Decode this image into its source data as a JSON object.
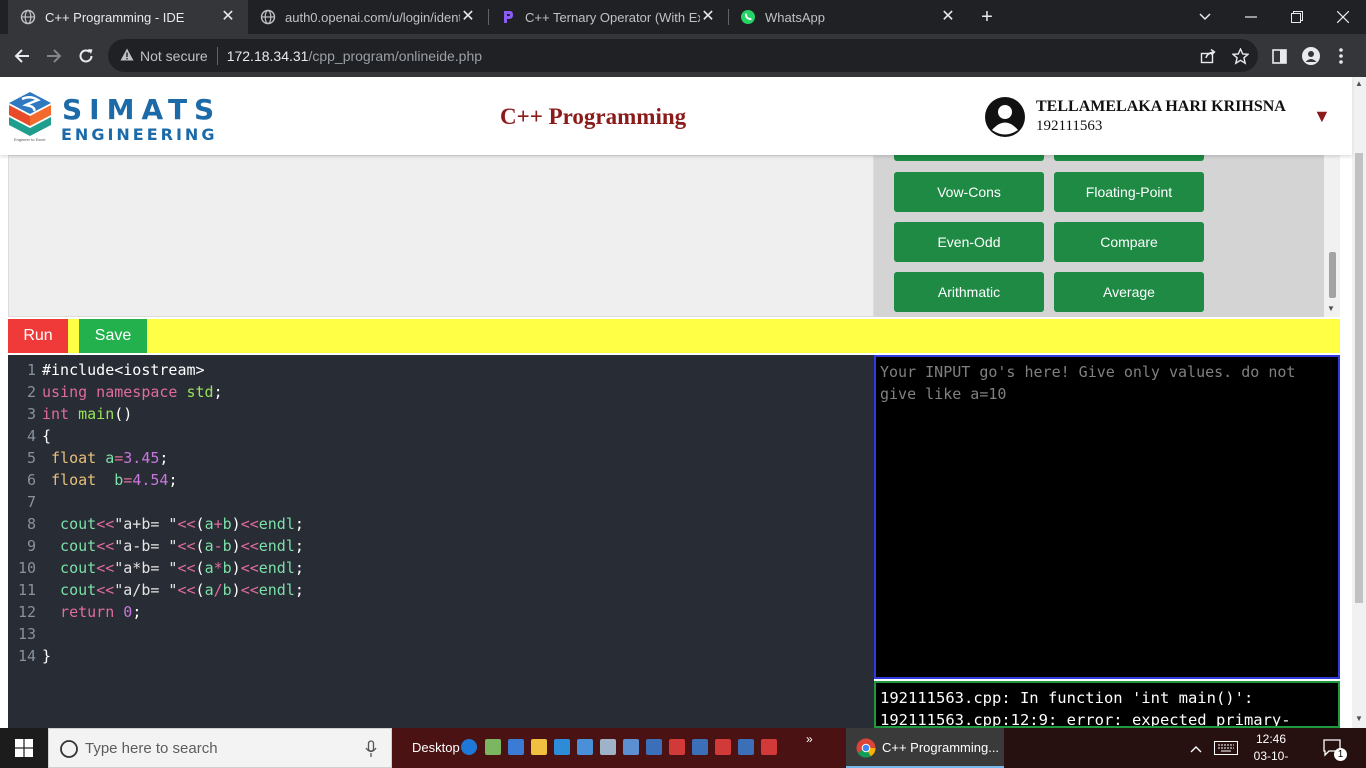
{
  "browser": {
    "tabs": [
      {
        "title": "C++ Programming - IDE",
        "active": true
      },
      {
        "title": "auth0.openai.com/u/login/identi",
        "active": false
      },
      {
        "title": "C++ Ternary Operator (With Exa",
        "active": false
      },
      {
        "title": "WhatsApp",
        "active": false
      }
    ],
    "address": {
      "security": "Not secure",
      "host": "172.18.34.31",
      "path": "/cpp_program/onlineide.php"
    }
  },
  "header": {
    "logo_line1": "SIMATS",
    "logo_line2": "ENGINEERING",
    "logo_tagline": "Engineer to Excel",
    "title": "C++ Programming",
    "user_name": "TELLAMELAKA HARI KRIHSNA",
    "user_id": "192111563",
    "caret": "▼"
  },
  "programs": {
    "buttons": [
      "Vow-Cons",
      "Floating-Point",
      "Even-Odd",
      "Compare",
      "Arithmatic",
      "Average"
    ]
  },
  "actions": {
    "run": "Run",
    "save": "Save"
  },
  "editor": {
    "lines": [
      {
        "n": "1",
        "tokens": [
          {
            "t": "#include<iostream>",
            "c": "plain"
          }
        ]
      },
      {
        "n": "2",
        "tokens": [
          {
            "t": "using namespace ",
            "c": "kw"
          },
          {
            "t": "std",
            "c": "fn"
          },
          {
            "t": ";",
            "c": "plain"
          }
        ]
      },
      {
        "n": "3",
        "tokens": [
          {
            "t": "int ",
            "c": "kw"
          },
          {
            "t": "main",
            "c": "fn"
          },
          {
            "t": "()",
            "c": "plain"
          }
        ]
      },
      {
        "n": "4",
        "tokens": [
          {
            "t": "{",
            "c": "plain"
          }
        ]
      },
      {
        "n": "5",
        "tokens": [
          {
            "t": " float ",
            "c": "type"
          },
          {
            "t": "a",
            "c": "var"
          },
          {
            "t": "=",
            "c": "op"
          },
          {
            "t": "3.45",
            "c": "num"
          },
          {
            "t": ";",
            "c": "plain"
          }
        ]
      },
      {
        "n": "6",
        "tokens": [
          {
            "t": " float  ",
            "c": "type"
          },
          {
            "t": "b",
            "c": "var"
          },
          {
            "t": "=",
            "c": "op"
          },
          {
            "t": "4.54",
            "c": "num"
          },
          {
            "t": ";",
            "c": "plain"
          }
        ]
      },
      {
        "n": "7",
        "tokens": []
      },
      {
        "n": "8",
        "tokens": [
          {
            "t": "  cout",
            "c": "var"
          },
          {
            "t": "<<",
            "c": "op"
          },
          {
            "t": "\"a+b= \"",
            "c": "str"
          },
          {
            "t": "<<",
            "c": "op"
          },
          {
            "t": "(",
            "c": "plain"
          },
          {
            "t": "a",
            "c": "var"
          },
          {
            "t": "+",
            "c": "op"
          },
          {
            "t": "b",
            "c": "var"
          },
          {
            "t": ")",
            "c": "plain"
          },
          {
            "t": "<<",
            "c": "op"
          },
          {
            "t": "endl",
            "c": "var"
          },
          {
            "t": ";",
            "c": "plain"
          }
        ]
      },
      {
        "n": "9",
        "tokens": [
          {
            "t": "  cout",
            "c": "var"
          },
          {
            "t": "<<",
            "c": "op"
          },
          {
            "t": "\"a-b= \"",
            "c": "str"
          },
          {
            "t": "<<",
            "c": "op"
          },
          {
            "t": "(",
            "c": "plain"
          },
          {
            "t": "a",
            "c": "var"
          },
          {
            "t": "-",
            "c": "op"
          },
          {
            "t": "b",
            "c": "var"
          },
          {
            "t": ")",
            "c": "plain"
          },
          {
            "t": "<<",
            "c": "op"
          },
          {
            "t": "endl",
            "c": "var"
          },
          {
            "t": ";",
            "c": "plain"
          }
        ]
      },
      {
        "n": "10",
        "tokens": [
          {
            "t": "  cout",
            "c": "var"
          },
          {
            "t": "<<",
            "c": "op"
          },
          {
            "t": "\"a*b= \"",
            "c": "str"
          },
          {
            "t": "<<",
            "c": "op"
          },
          {
            "t": "(",
            "c": "plain"
          },
          {
            "t": "a",
            "c": "var"
          },
          {
            "t": "*",
            "c": "op"
          },
          {
            "t": "b",
            "c": "var"
          },
          {
            "t": ")",
            "c": "plain"
          },
          {
            "t": "<<",
            "c": "op"
          },
          {
            "t": "endl",
            "c": "var"
          },
          {
            "t": ";",
            "c": "plain"
          }
        ]
      },
      {
        "n": "11",
        "tokens": [
          {
            "t": "  cout",
            "c": "var"
          },
          {
            "t": "<<",
            "c": "op"
          },
          {
            "t": "\"a/b= \"",
            "c": "str"
          },
          {
            "t": "<<",
            "c": "op"
          },
          {
            "t": "(",
            "c": "plain"
          },
          {
            "t": "a",
            "c": "var"
          },
          {
            "t": "/",
            "c": "op"
          },
          {
            "t": "b",
            "c": "var"
          },
          {
            "t": ")",
            "c": "plain"
          },
          {
            "t": "<<",
            "c": "op"
          },
          {
            "t": "endl",
            "c": "var"
          },
          {
            "t": ";",
            "c": "plain"
          }
        ]
      },
      {
        "n": "12",
        "tokens": [
          {
            "t": "  return ",
            "c": "kw"
          },
          {
            "t": "0",
            "c": "num"
          },
          {
            "t": ";",
            "c": "plain"
          }
        ]
      },
      {
        "n": "13",
        "tokens": []
      },
      {
        "n": "14",
        "tokens": [
          {
            "t": "}",
            "c": "plain"
          }
        ]
      }
    ]
  },
  "input": {
    "placeholder": "Your INPUT go's here! Give only values. do not give like a=10"
  },
  "output": {
    "lines": [
      "192111563.cpp: In function 'int main()':",
      "192111563.cpp:12:9: error: expected primary-"
    ]
  },
  "taskbar": {
    "search_placeholder": "Type here to search",
    "desktop_label": "Desktop",
    "active_app": "C++ Programming...",
    "time": "12:46",
    "date": "03-10-2023",
    "notification_count": "1"
  },
  "colors": {
    "program_button": "#1e8a44",
    "run_button": "#f03a3a",
    "save_button": "#22b14c",
    "action_bar": "#ffff45",
    "title_color": "#8b1a1a",
    "logo_blue": "#1c6aa8"
  }
}
